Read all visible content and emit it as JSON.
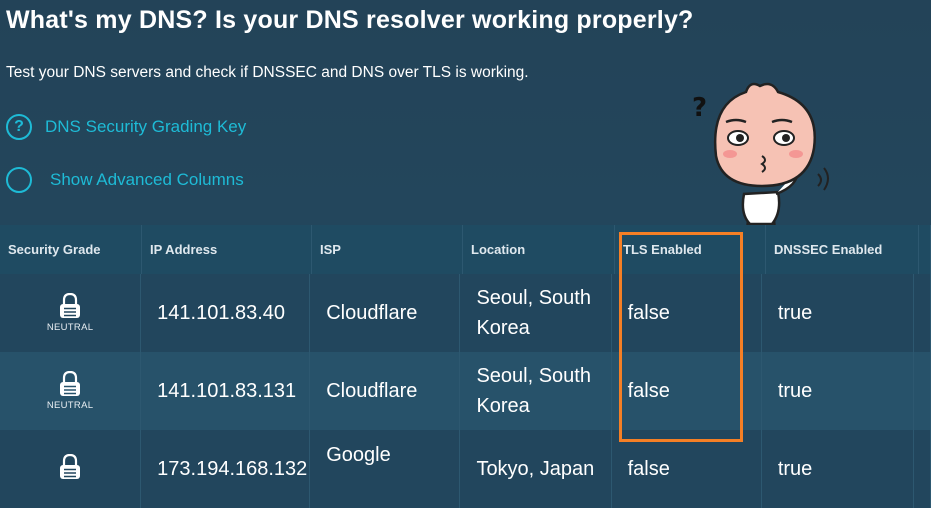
{
  "page": {
    "title": "What's my DNS? Is your DNS resolver working properly?",
    "subtitle": "Test your DNS servers and check if DNSSEC and DNS over TLS is working."
  },
  "options": [
    {
      "label": "DNS Security Grading Key",
      "icon": "?"
    },
    {
      "label": "Show Advanced Columns",
      "icon": ""
    }
  ],
  "table": {
    "headers": [
      "Security Grade",
      "IP Address",
      "ISP",
      "Location",
      "TLS Enabled",
      "DNSSEC Enabled"
    ],
    "rows": [
      {
        "grade": "NEUTRAL",
        "ip": "141.101.83.40",
        "isp": "Cloudflare",
        "location": "Seoul, South Korea",
        "tls": "false",
        "dnssec": "true"
      },
      {
        "grade": "NEUTRAL",
        "ip": "141.101.83.131",
        "isp": "Cloudflare",
        "location": "Seoul, South Korea",
        "tls": "false",
        "dnssec": "true"
      },
      {
        "grade": "",
        "ip": "173.194.168.132",
        "isp": "Google",
        "location": "Tokyo, Japan",
        "tls": "false",
        "dnssec": "true"
      }
    ]
  },
  "colors": {
    "accent": "#1ebbd6",
    "highlight": "#f57f25"
  },
  "sticker": {
    "icon": "confused-peach-character",
    "mark": "?"
  }
}
